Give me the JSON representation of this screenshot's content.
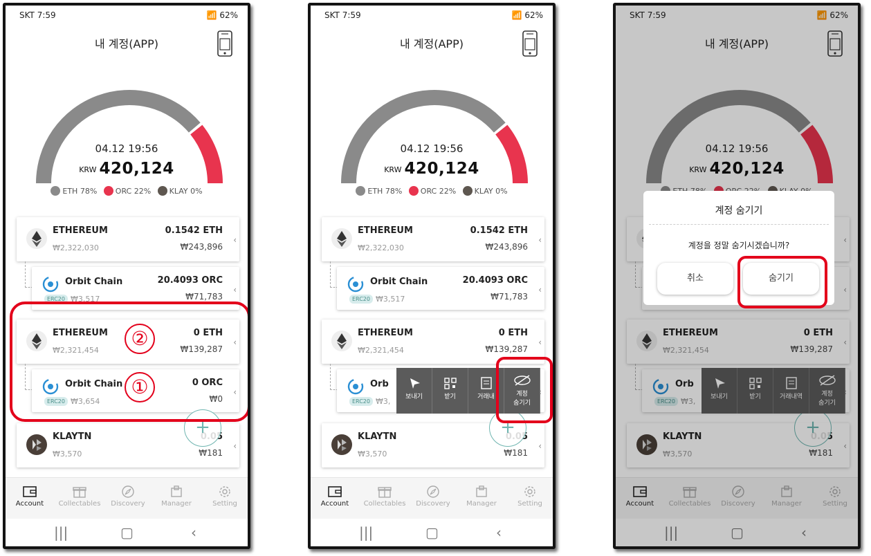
{
  "status": {
    "carrier_time": "SKT 7:59",
    "battery": "62%"
  },
  "header": {
    "title": "내 계정(APP)"
  },
  "summary": {
    "datetime": "04.12 19:56",
    "currency": "KRW",
    "balance": "420,124",
    "legend": [
      {
        "label": "ETH 78%",
        "color": "#8a8a8a"
      },
      {
        "label": "ORC 22%",
        "color": "#e8344e"
      },
      {
        "label": "KLAY 0%",
        "color": "#5e5750"
      }
    ],
    "gauge_share": {
      "eth": 0.78,
      "orc": 0.22
    }
  },
  "accounts": [
    {
      "name": "ETHEREUM",
      "price": "₩2,322,030",
      "amount": "0.1542 ETH",
      "value": "₩243,896"
    },
    {
      "name": "Orbit Chain",
      "badge": "ERC20",
      "price": "₩3,517",
      "amount": "20.4093 ORC",
      "value": "₩71,783"
    },
    {
      "name": "ETHEREUM",
      "price": "₩2,321,454",
      "amount": "0 ETH",
      "value": "₩139,287"
    },
    {
      "name": "Orbit Chain",
      "badge": "ERC20",
      "price": "₩3,654",
      "amount": "0 ORC",
      "value": "₩0"
    },
    {
      "name": "KLAYTN",
      "price": "₩3,570",
      "amount": "0.05",
      "value": "₩181"
    }
  ],
  "truncated": {
    "orbit_name": "Orb",
    "orbit_price": "₩3,",
    "klay_amount": "0.05"
  },
  "actions": [
    {
      "label": "보내기",
      "icon": "send-icon"
    },
    {
      "label": "받기",
      "icon": "qr-icon"
    },
    {
      "label": "거래내역",
      "icon": "history-icon"
    },
    {
      "label_line1": "계정",
      "label_line2": "숨기기",
      "icon": "eye-off-icon"
    }
  ],
  "actions_p2_history": "거래내",
  "annotations": {
    "one": "①",
    "two": "②"
  },
  "dialog": {
    "title": "계정 숨기기",
    "message": "계정을 정말 숨기시겠습니까?",
    "cancel": "취소",
    "confirm": "숨기기"
  },
  "nav": [
    {
      "label": "Account",
      "icon": "wallet-icon"
    },
    {
      "label": "Collectables",
      "icon": "gift-icon"
    },
    {
      "label": "Discovery",
      "icon": "compass-icon"
    },
    {
      "label": "Manager",
      "icon": "manager-icon"
    },
    {
      "label": "Setting",
      "icon": "gear-icon"
    }
  ],
  "fab_label": "+",
  "accent": {
    "red": "#e3001b",
    "teal": "#6fb5b0"
  }
}
